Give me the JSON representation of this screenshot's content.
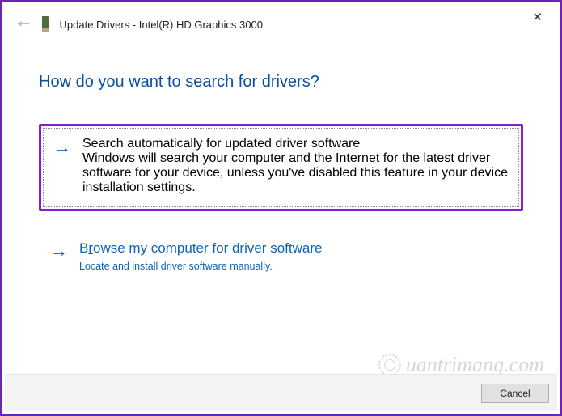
{
  "window": {
    "title": "Update Drivers - Intel(R) HD Graphics 3000"
  },
  "heading": "How do you want to search for drivers?",
  "options": {
    "auto": {
      "title_prefix": "S",
      "title_rest": "earch automatically for updated driver software",
      "desc": "Windows will search your computer and the Internet for the latest driver software for your device, unless you've disabled this feature in your device installation settings."
    },
    "browse": {
      "title_prefix": "B",
      "title_mid": "r",
      "title_rest": "owse my computer for driver software",
      "desc": "Locate and install driver software manually."
    }
  },
  "buttons": {
    "cancel": "Cancel"
  },
  "watermark": "uantrimang.com"
}
